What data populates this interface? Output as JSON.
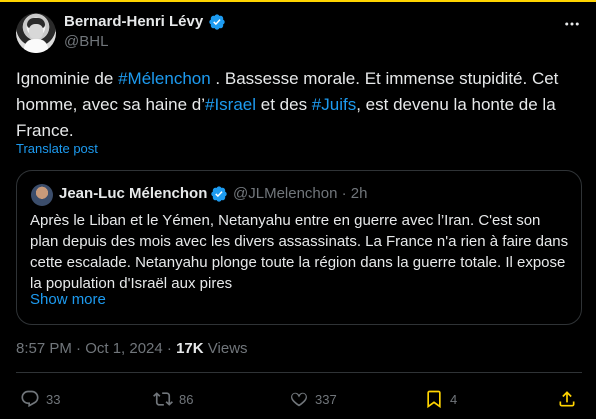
{
  "author": {
    "name": "Bernard-Henri Lévy",
    "handle": "@BHL"
  },
  "tweet": {
    "segments": [
      {
        "text": "Ignominie de ",
        "hashtag": false
      },
      {
        "text": "#Mélenchon",
        "hashtag": true
      },
      {
        "text": " . Bassesse morale. Et immense stupidité. Cet homme, avec sa haine d’",
        "hashtag": false
      },
      {
        "text": "#Israel",
        "hashtag": true
      },
      {
        "text": " et des ",
        "hashtag": false
      },
      {
        "text": "#Juifs",
        "hashtag": true
      },
      {
        "text": ", est devenu la honte de la France.",
        "hashtag": false
      }
    ],
    "translate_label": "Translate post"
  },
  "quote": {
    "name": "Jean-Luc Mélenchon",
    "handle_time": "@JLMelenchon · 2h",
    "text": "Après le Liban et le Yémen, Netanyahu entre en  guerre avec l’Iran. C'est son plan depuis des mois avec les divers assassinats. La France n'a rien à faire dans cette escalade. Netanyahu plonge toute la région dans la guerre totale. Il expose la population d'Israël aux pires",
    "show_more": "Show more"
  },
  "meta": {
    "timestamp": "8:57 PM · Oct 1, 2024",
    "separator": " · ",
    "views": "17K",
    "views_label": " Views"
  },
  "actions": {
    "replies": "33",
    "reposts": "86",
    "likes": "337",
    "bookmarks": "4"
  },
  "colors": {
    "background": "#000000",
    "text": "#e7e9ea",
    "muted": "#71767b",
    "accent": "#1d9bf0",
    "verified": "#1d9bf0",
    "border": "#2f3336",
    "top_stripe": "#ffd400"
  },
  "icons": [
    "more-icon",
    "verified-icon",
    "reply-icon",
    "repost-icon",
    "like-icon",
    "bookmark-icon",
    "share-icon"
  ]
}
